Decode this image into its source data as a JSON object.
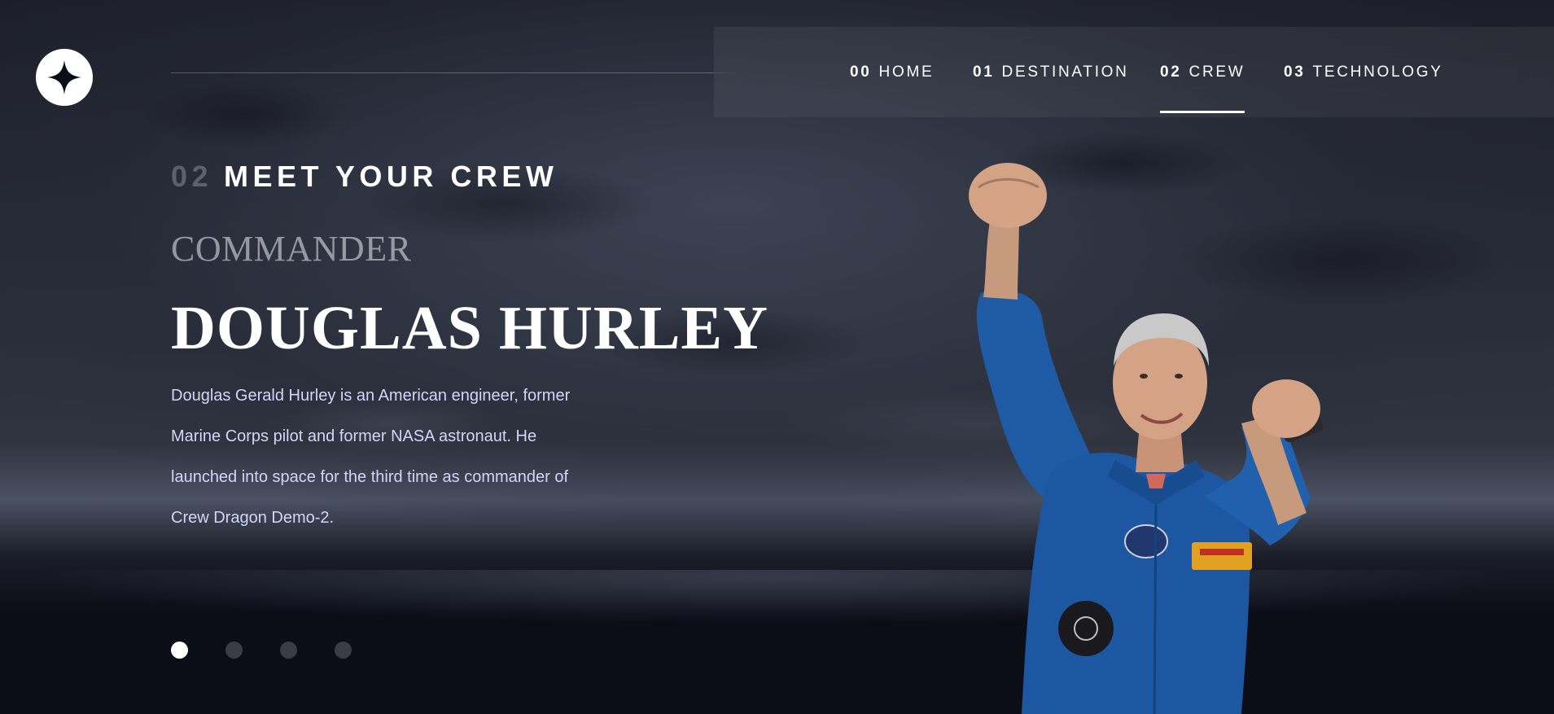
{
  "brand": {
    "logo_icon": "star-logo-icon"
  },
  "nav": {
    "items": [
      {
        "num": "00",
        "label": "HOME",
        "active": false
      },
      {
        "num": "01",
        "label": "DESTINATION",
        "active": false
      },
      {
        "num": "02",
        "label": "CREW",
        "active": true
      },
      {
        "num": "03",
        "label": "TECHNOLOGY",
        "active": false
      }
    ]
  },
  "main": {
    "subheading_num": "02",
    "subheading_text": "MEET YOUR CREW",
    "role": "COMMANDER",
    "name": "DOUGLAS HURLEY",
    "bio": "Douglas Gerald Hurley is an American engineer, former Marine Corps pilot and former NASA astronaut. He launched into space for the third time as commander of Crew Dragon Demo-2.",
    "slider": {
      "count": 4,
      "active_index": 0
    }
  },
  "colors": {
    "background": "#0b0d17",
    "accent_text": "#d0d6f9",
    "white": "#ffffff"
  }
}
